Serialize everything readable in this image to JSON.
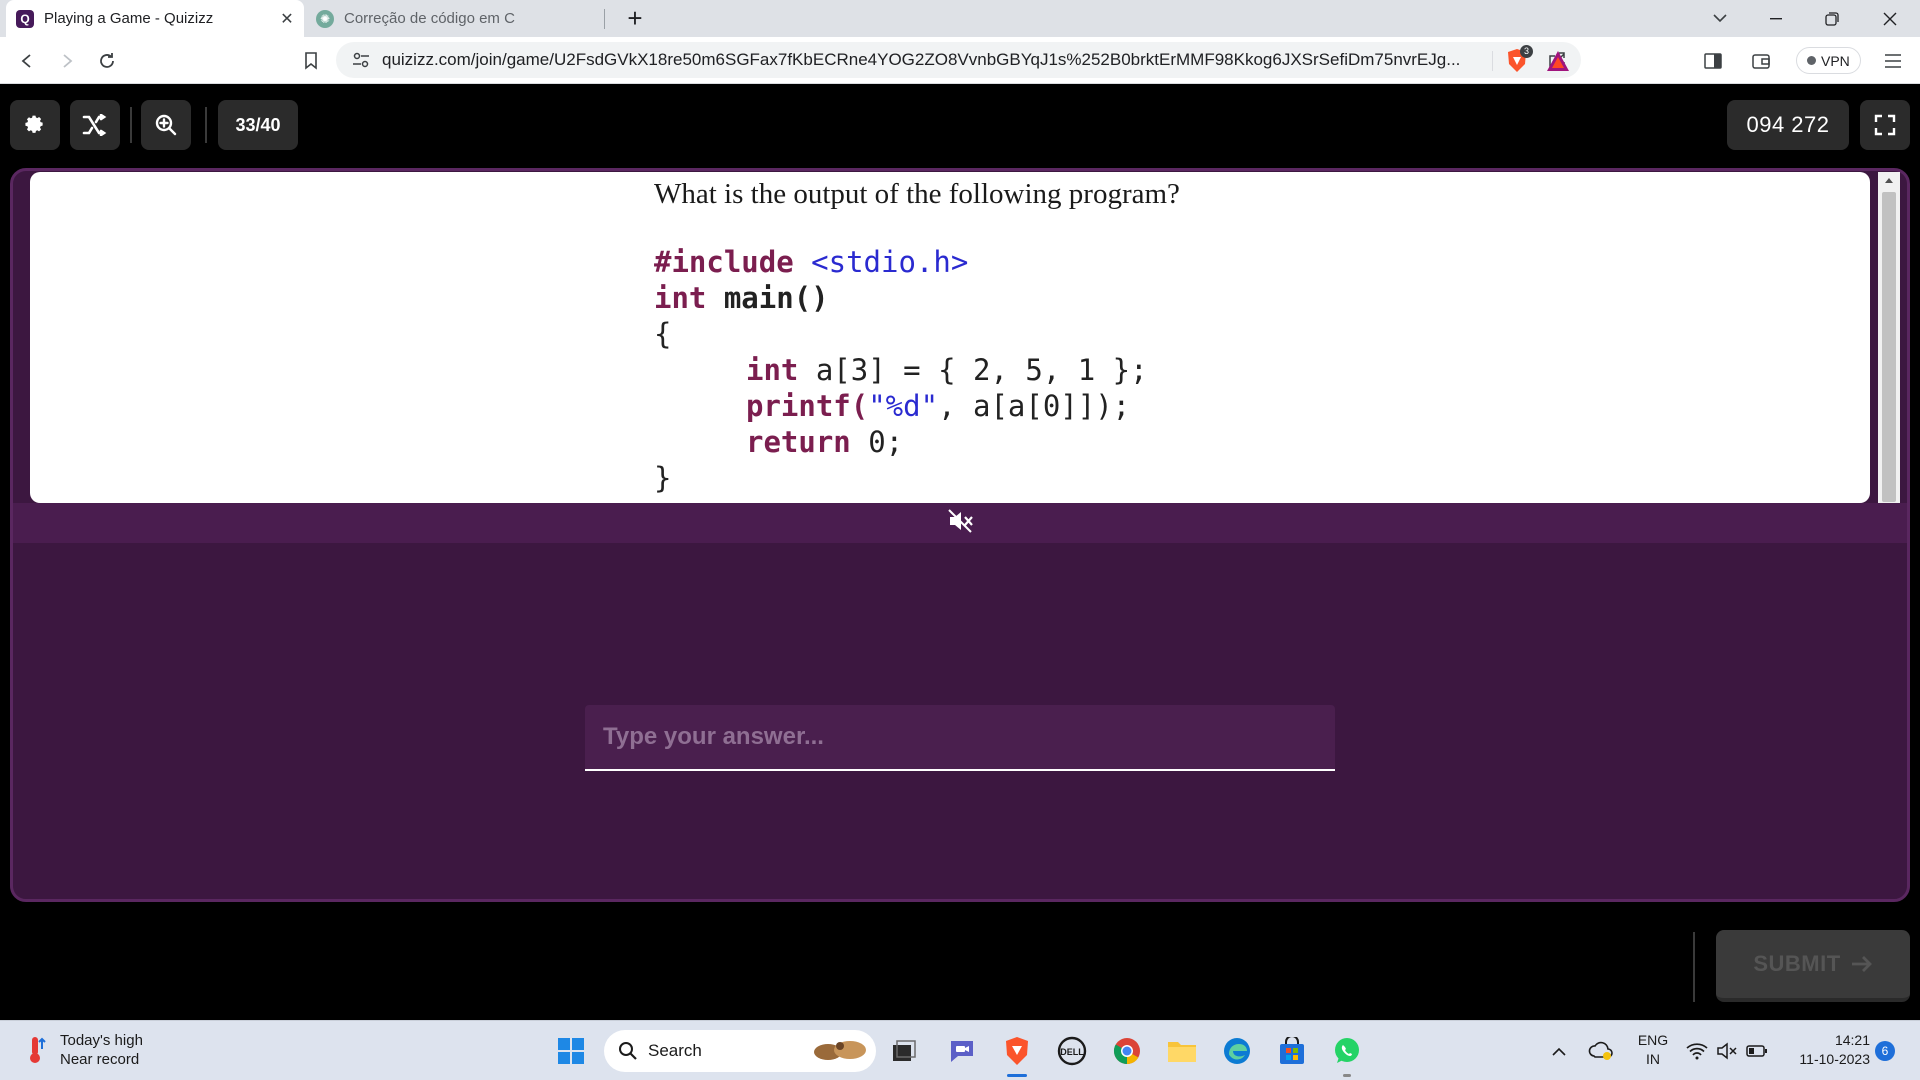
{
  "browser": {
    "tabs": [
      {
        "title": "Playing a Game - Quizizz",
        "active": true,
        "favicon": "quizizz-icon"
      },
      {
        "title": "Correção de código em C",
        "active": false,
        "favicon": "chatgpt-icon"
      }
    ],
    "url": "quizizz.com/join/game/U2FsdGVkX18re50m6SGFax7fKbECRne4YOG2ZO8VvnbGBYqJ1s%252B0brktErMMF98Kkog6JXSrSefiDm75nvrEJg...",
    "vpn_label": "VPN",
    "brave_badge": "3"
  },
  "game": {
    "question_counter": "33/40",
    "game_code": "094 272",
    "question_text": "What is the output of the following program?",
    "code": {
      "line1_pp": "#include",
      "line1_inc": " <stdio.h>",
      "line2_kw": "int",
      "line2_rest": " main()",
      "line3": "{",
      "line4_kw": "int",
      "line4_rest": " a[3] = { 2, 5, 1 };",
      "line5_fn": "printf(",
      "line5_str": "\"%d\"",
      "line5_rest": ", a[a[0]]);",
      "line6_kw": "return",
      "line6_rest": " 0;",
      "line7": "}"
    },
    "answer_placeholder": "Type your answer...",
    "submit_label": "SUBMIT"
  },
  "taskbar": {
    "weather_line1": "Today's high",
    "weather_line2": "Near record",
    "search_placeholder": "Search",
    "lang_line1": "ENG",
    "lang_line2": "IN",
    "time": "14:21",
    "date": "11-10-2023",
    "notification_count": "6"
  },
  "colors": {
    "panel_bg": "#3c1740",
    "keyword": "#7b1e4f",
    "string": "#2a2ad0"
  }
}
